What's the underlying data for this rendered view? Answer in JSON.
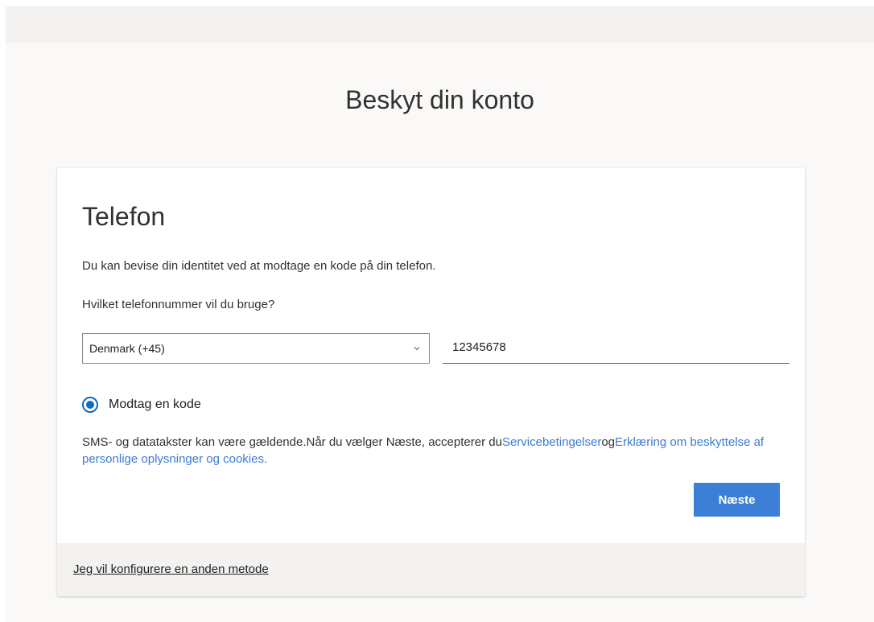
{
  "page": {
    "title": "Beskyt din konto"
  },
  "card": {
    "title": "Telefon",
    "description": "Du kan bevise din identitet ved at modtage en kode på din telefon.",
    "question": "Hvilket telefonnummer vil du bruge?",
    "country_select": {
      "value": "Denmark (+45)",
      "icon": "chevron-down-icon"
    },
    "phone_input": {
      "value": "12345678"
    },
    "radio": {
      "label": "Modtag en kode",
      "selected": true
    },
    "legal": {
      "text": "SMS- og datatakster kan være gældende.Når du vælger Næste, accepterer du",
      "terms_link": "Servicebetingelser",
      "connector": "og",
      "privacy_link": "Erklæring om beskyttelse af personlige oplysninger og cookies."
    },
    "next_button": "Næste",
    "footer_link": "Jeg vil konfigurere en anden metode"
  },
  "colors": {
    "accent": "#0f6cbd",
    "button": "#3b7fd6",
    "link": "#3b7bd4",
    "footer_bg": "#f3f2f1"
  }
}
